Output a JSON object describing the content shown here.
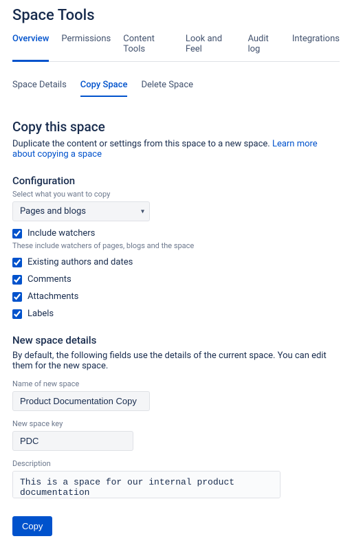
{
  "pageTitle": "Space Tools",
  "mainTabs": [
    "Overview",
    "Permissions",
    "Content Tools",
    "Look and Feel",
    "Audit log",
    "Integrations"
  ],
  "subTabs": [
    "Space Details",
    "Copy Space",
    "Delete Space"
  ],
  "heading": "Copy this space",
  "headingDesc": "Duplicate the content or settings from this space to a new space. ",
  "learnMore": "Learn more about copying a space",
  "configTitle": "Configuration",
  "configHelper": "Select what you want to copy",
  "selectValue": "Pages and blogs",
  "includeWatchers": "Include watchers",
  "watchersHelper": "These include watchers of pages, blogs and the space",
  "opts": {
    "authors": "Existing authors and dates",
    "comments": "Comments",
    "attachments": "Attachments",
    "labels": "Labels"
  },
  "newSpaceTitle": "New space details",
  "newSpaceDesc": "By default, the following fields use the details of the current space. You can edit them for the new space.",
  "nameLabel": "Name of new space",
  "nameValue": "Product Documentation Copy",
  "keyLabel": "New space key",
  "keyValue": "PDC",
  "descLabel": "Description",
  "descValue": "This is a space for our internal product documentation",
  "copyBtn": "Copy"
}
